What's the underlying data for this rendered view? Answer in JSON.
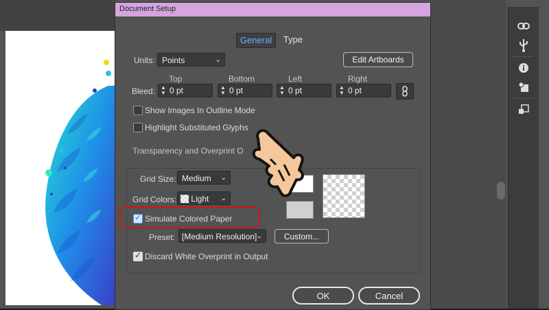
{
  "dialog": {
    "title": "Document Setup",
    "tabs": {
      "general": "General",
      "type": "Type"
    },
    "units": {
      "label": "Units:",
      "value": "Points"
    },
    "edit_artboards": "Edit Artboards",
    "bleed": {
      "label": "Bleed:",
      "headers": {
        "top": "Top",
        "bottom": "Bottom",
        "left": "Left",
        "right": "Right"
      },
      "values": {
        "top": "0 pt",
        "bottom": "0 pt",
        "left": "0 pt",
        "right": "0 pt"
      }
    },
    "options": {
      "show_images_outline": "Show Images In Outline Mode",
      "highlight_glyphs": "Highlight Substituted Glyphs"
    },
    "transparency": {
      "section_title": "Transparency and Overprint O",
      "grid_size": {
        "label": "Grid Size:",
        "value": "Medium"
      },
      "grid_colors": {
        "label": "Grid Colors:",
        "value": "Light"
      },
      "simulate_paper": {
        "label": "Simulate Colored Paper",
        "checked": true
      },
      "preset": {
        "label": "Preset:",
        "value": "[Medium Resolution]"
      },
      "custom_button": "Custom...",
      "discard_white": {
        "label": "Discard White Overprint in Output",
        "checked": true
      }
    },
    "ok": "OK",
    "cancel": "Cancel"
  },
  "colors": {
    "titlebar": "#d4a4de",
    "active_tab": "#6ab0ff",
    "highlight": "#d01515"
  },
  "icons": [
    "link-icon",
    "usb-icon",
    "info-icon",
    "graphic-styles-icon",
    "artboard-icon",
    "pointing-hand-icon"
  ]
}
